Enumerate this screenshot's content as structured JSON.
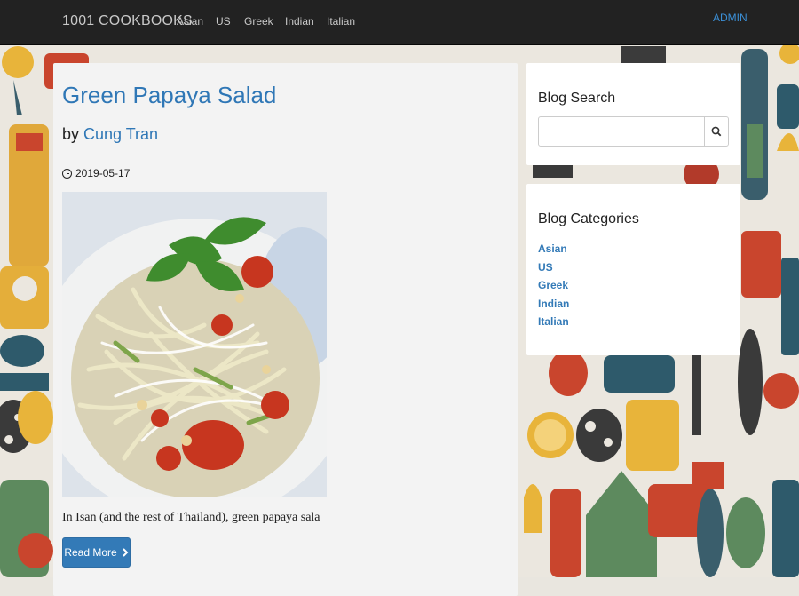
{
  "navbar": {
    "brand": "1001 COOKBOOKS",
    "links": [
      "Asian",
      "US",
      "Greek",
      "Indian",
      "Italian"
    ],
    "admin": "ADMIN"
  },
  "post": {
    "title": "Green Papaya Salad",
    "by_prefix": "by ",
    "author": "Cung Tran",
    "date": "2019-05-17",
    "excerpt": "In Isan (and the rest of Thailand), green papaya sala",
    "read_more": "Read More",
    "icons": {
      "date": "clock-icon",
      "read_more": "chevron-right-icon"
    }
  },
  "sidebar": {
    "search": {
      "title": "Blog Search",
      "placeholder": "",
      "icon": "search-icon"
    },
    "categories": {
      "title": "Blog Categories",
      "items": [
        "Asian",
        "US",
        "Greek",
        "Indian",
        "Italian"
      ]
    }
  },
  "colors": {
    "navbar": "#222222",
    "link": "#337ab7",
    "title": "#2f77b6",
    "button": "#337ab7",
    "admin": "#3b8fd6"
  }
}
